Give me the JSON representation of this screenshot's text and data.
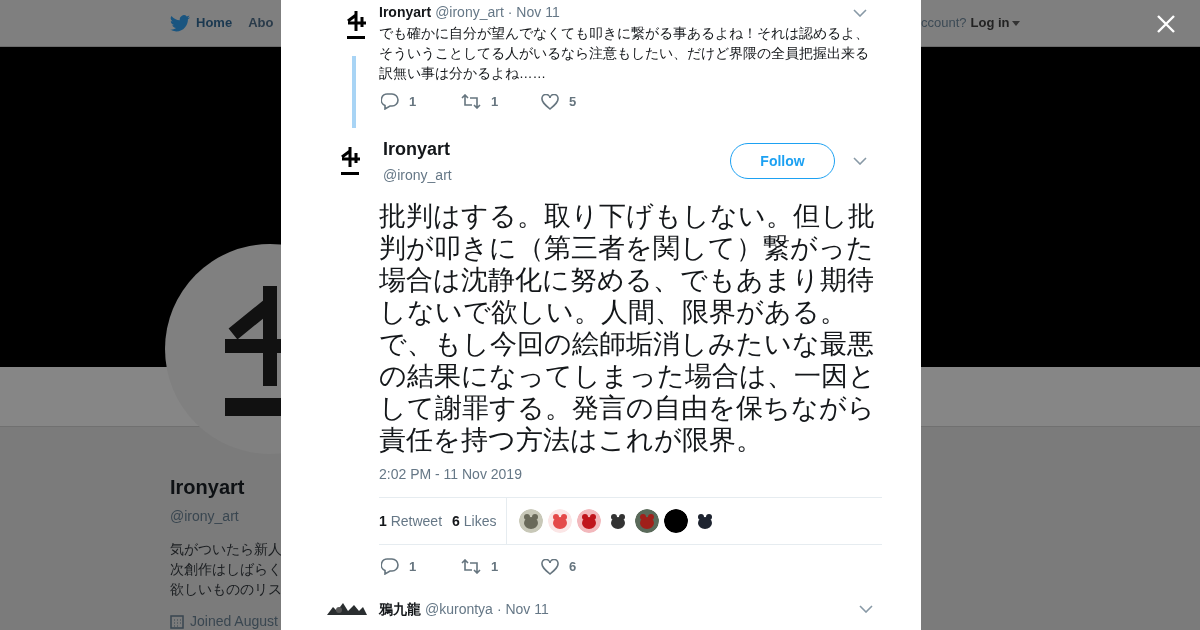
{
  "nav": {
    "home": "Home",
    "about": "Abo",
    "account": "ccount?",
    "login": "Log in"
  },
  "profile": {
    "name": "Ironyart",
    "handle": "@irony_art",
    "bio": [
      "気がついたら新人",
      "次創作はしばらく",
      "欲しいもののリス"
    ],
    "joined": "Joined August"
  },
  "thread": [
    {
      "kind": "reply",
      "name": "Ironyart",
      "handle": "@irony_art",
      "date": "· Nov 11",
      "text_lines": [
        "でも確かに自分が望んでなくても叩きに繋がる事あるよね！それは認めるよ、",
        "そういうことしてる人がいるなら注意もしたい、だけど界隈の全員把握出来る",
        "訳無い事は分かるよね……"
      ],
      "replies": "1",
      "retweets": "1",
      "likes": "5"
    },
    {
      "kind": "main",
      "name": "Ironyart",
      "handle": "@irony_art",
      "follow": "Follow",
      "text": "批判はする。取り下げもしない。但し批判が叩きに（第三者を関して）繋がった場合は沈静化に努める、でもあまり期待しないで欲しい。人間、限界がある。で、もし今回の絵師垢消しみたいな最悪の結果になってしまった場合は、一因として謝罪する。発言の自由を保ちながら責任を持つ方法はこれが限界。",
      "time": "2:02 PM - 11 Nov 2019",
      "retweet_count": "1",
      "retweet_label": "Retweet",
      "like_count": "6",
      "like_label": "Likes",
      "replies": "1",
      "retweets": "1",
      "likes": "6"
    },
    {
      "kind": "next",
      "name": "鴉九龍",
      "handle": "@kurontya",
      "date": "· Nov 11"
    }
  ]
}
